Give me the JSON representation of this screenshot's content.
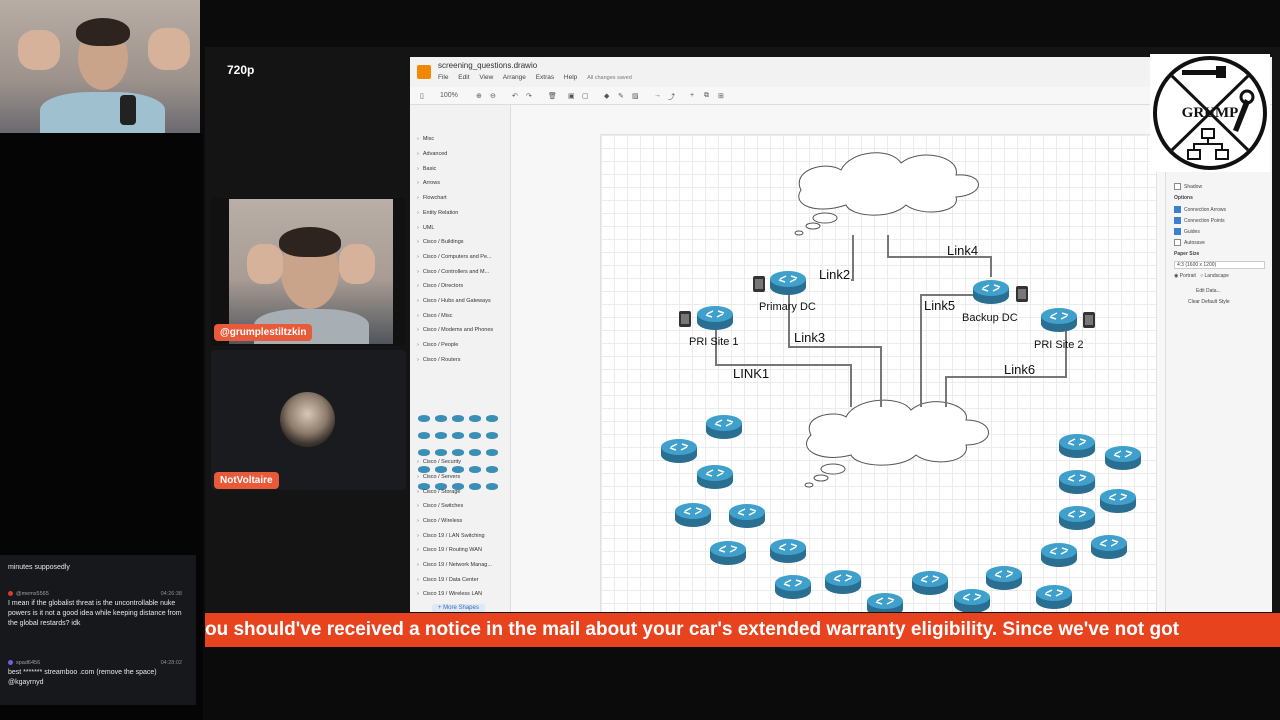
{
  "stream": {
    "quality": "720p",
    "host_name": "@grumplestiltzkin",
    "guest_name": "NotVoltaire",
    "ticker": "ou should've received a notice in the mail about your car's extended warranty eligibility. Since we've not got"
  },
  "chat": {
    "messages": [
      {
        "user": "",
        "time": "",
        "text": "minutes supposedly"
      },
      {
        "user": "@mems5565",
        "time": "04:26:38",
        "text": "I mean if the globalist threat is the uncontrollable nuke powers is it not a good idea while keeping distance from the global restards? idk"
      },
      {
        "user": "spad6456",
        "time": "04:28:02",
        "text": "best ******* streamboo .com (remove the space) @kgayrnyd"
      }
    ]
  },
  "drawio": {
    "title": "screening_questions.drawio",
    "menu": [
      "File",
      "Edit",
      "View",
      "Arrange",
      "Extras",
      "Help"
    ],
    "saved_status": "All changes saved",
    "zoom": "100%",
    "libraries": [
      "Misc",
      "Advanced",
      "Basic",
      "Arrows",
      "Flowchart",
      "Entity Relation",
      "UML",
      "Cisco / Buildings",
      "Cisco / Computers and Pe...",
      "Cisco / Controllers and M...",
      "Cisco / Directors",
      "Cisco / Hubs and Gateways",
      "Cisco / Misc",
      "Cisco / Modems and Phones",
      "Cisco / People",
      "Cisco / Routers",
      "Cisco / Security",
      "Cisco / Servers",
      "Cisco / Storage",
      "Cisco / Switches",
      "Cisco / Wireless",
      "Cisco 19 / LAN Switching",
      "Cisco 19 / Routing WAN",
      "Cisco 19 / Network Manag...",
      "Cisco 19 / Data Center",
      "Cisco 19 / Wireless LAN"
    ],
    "more_shapes": "+ More Shapes",
    "format_panel": {
      "shadow": "Shadow",
      "options_title": "Options",
      "connection_arrows": "Connection Arrows",
      "connection_points": "Connection Points",
      "guides": "Guides",
      "autosave": "Autosave",
      "paper_size_title": "Paper Size",
      "paper_size": "4:3 (1600 x 1200)",
      "portrait": "Portrait",
      "landscape": "Landscape",
      "edit_data": "Edit Data...",
      "clear_default_style": "Clear Default Style"
    },
    "diagram": {
      "nodes": {
        "primary_dc": "Primary DC",
        "backup_dc": "Backup DC",
        "pri_site_1": "PRI Site 1",
        "pri_site_2": "PRI Site 2"
      },
      "links": {
        "link1": "LINK1",
        "link2": "Link2",
        "link3": "Link3",
        "link4": "Link4",
        "link5": "Link5",
        "link6": "Link6"
      }
    }
  },
  "logo": {
    "text": "GRUMP"
  },
  "colors": {
    "ticker": "#e8431f",
    "name_tag": "#e85a3a",
    "router": "#3a8fb7",
    "drawio_accent": "#f08705"
  }
}
